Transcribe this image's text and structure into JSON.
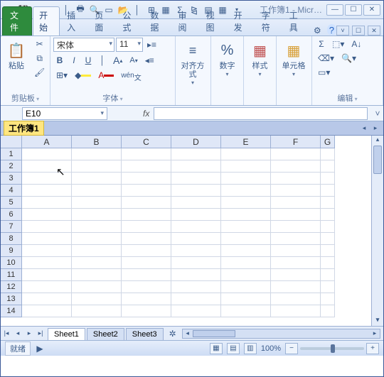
{
  "title": "工作簿1 - Micr…",
  "qat_icons": [
    "excel-icon",
    "save-icon",
    "undo-icon",
    "redo-icon",
    "divider",
    "print-icon",
    "preview-icon",
    "divider",
    "cut-icon",
    "copy-icon",
    "paste-icon",
    "format-painter-icon",
    "divider",
    "table-icon",
    "sum-icon",
    "sort-icon",
    "form-icon"
  ],
  "tabs": {
    "file": "文件",
    "items": [
      "开始",
      "插入",
      "页面",
      "公式",
      "数据",
      "审阅",
      "视图",
      "开发",
      "字符",
      "工具"
    ],
    "active": 0
  },
  "ribbon": {
    "clipboard": {
      "label": "剪贴板",
      "paste": "粘贴"
    },
    "font": {
      "label": "字体",
      "fontname": "宋体",
      "fontsize": "11",
      "bold": "B",
      "italic": "I",
      "underline": "U",
      "grow": "A",
      "shrink": "A",
      "phonetic": "wén"
    },
    "align": {
      "label": "对齐方式"
    },
    "number": {
      "label": "数字",
      "pct": "%"
    },
    "style": {
      "label": "样式"
    },
    "cells": {
      "label": "单元格"
    },
    "edit": {
      "label": "编辑",
      "sum": "Σ"
    }
  },
  "namebox": {
    "ref": "E10",
    "fx": "fx"
  },
  "workbook": {
    "title": "工作簿1"
  },
  "columns": [
    "A",
    "B",
    "C",
    "D",
    "E",
    "F",
    "G"
  ],
  "rows": [
    1,
    2,
    3,
    4,
    5,
    6,
    7,
    8,
    9,
    10,
    11,
    12,
    13,
    14
  ],
  "sheets": [
    "Sheet1",
    "Sheet2",
    "Sheet3"
  ],
  "status": {
    "ready": "就绪",
    "zoom": "100%"
  }
}
